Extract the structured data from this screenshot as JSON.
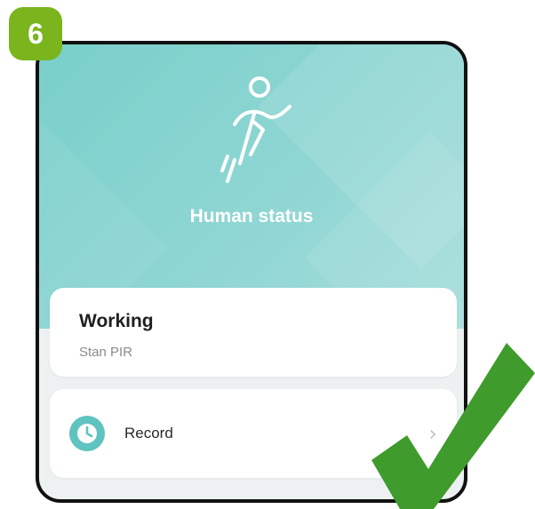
{
  "step": {
    "number": "6"
  },
  "hero": {
    "title": "Human status",
    "icon": "running-person-icon",
    "gradient_from": "#79cfcb",
    "gradient_to": "#a6dedc"
  },
  "status_card": {
    "value": "Working",
    "label": "Stan PIR"
  },
  "record_card": {
    "label": "Record",
    "icon": "clock-icon",
    "chevron": "›"
  },
  "overlay": {
    "icon": "checkmark-icon",
    "color": "#3e9b2c"
  },
  "colors": {
    "badge": "#7ab51d",
    "accent": "#5fc3c0"
  }
}
